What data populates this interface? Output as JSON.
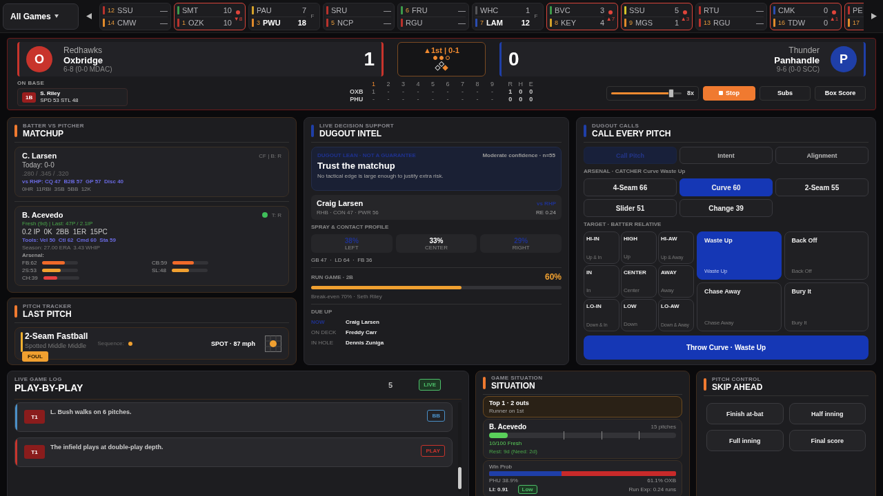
{
  "ticker": {
    "menu": "All Games",
    "games": [
      {
        "live": false,
        "teams": [
          {
            "seed": "12",
            "abbr": "SSU",
            "score": "—",
            "color": "#b8322c",
            "winner": false
          },
          {
            "seed": "14",
            "abbr": "CMW",
            "score": "—",
            "color": "#e08a2a",
            "winner": false
          }
        ]
      },
      {
        "live": true,
        "inning": "▼8",
        "teams": [
          {
            "abbr": "SMT",
            "score": "10",
            "color": "#3d9a4a",
            "winner": false
          },
          {
            "seed": "1",
            "abbr": "OZK",
            "score": "10",
            "color": "#b8322c",
            "winner": false
          }
        ]
      },
      {
        "live": false,
        "status": "F",
        "teams": [
          {
            "abbr": "PAU",
            "score": "7",
            "color": "#d4a22a",
            "winner": false
          },
          {
            "seed": "3",
            "abbr": "PWU",
            "score": "18",
            "color": "#e08a2a",
            "winner": true
          }
        ]
      },
      {
        "live": false,
        "teams": [
          {
            "abbr": "SRU",
            "score": "—",
            "color": "#b8322c",
            "winner": false
          },
          {
            "seed": "5",
            "abbr": "NCP",
            "score": "—",
            "color": "#b8322c",
            "winner": false
          }
        ]
      },
      {
        "live": false,
        "teams": [
          {
            "seed": "6",
            "abbr": "FRU",
            "score": "—",
            "color": "#3d9a4a",
            "winner": false
          },
          {
            "abbr": "RGU",
            "score": "—",
            "color": "#b8322c",
            "winner": false
          }
        ]
      },
      {
        "live": false,
        "status": "F",
        "teams": [
          {
            "abbr": "WHC",
            "score": "1",
            "color": "#555558",
            "winner": false
          },
          {
            "seed": "7",
            "abbr": "LAM",
            "score": "12",
            "color": "#2b4db0",
            "winner": true
          }
        ]
      },
      {
        "live": true,
        "inning": "▲7",
        "teams": [
          {
            "abbr": "BVC",
            "score": "3",
            "color": "#3d9a4a",
            "winner": false
          },
          {
            "seed": "8",
            "abbr": "KEY",
            "score": "4",
            "color": "#d4a22a",
            "winner": false
          }
        ]
      },
      {
        "live": true,
        "inning": "▲3",
        "teams": [
          {
            "abbr": "SSU",
            "score": "5",
            "color": "#d4c42a",
            "winner": false
          },
          {
            "seed": "9",
            "abbr": "MGS",
            "score": "1",
            "color": "#e08a2a",
            "winner": false
          }
        ]
      },
      {
        "live": false,
        "teams": [
          {
            "abbr": "RTU",
            "score": "—",
            "color": "#b8322c",
            "winner": false
          },
          {
            "seed": "13",
            "abbr": "RGU",
            "score": "—",
            "color": "#b8322c",
            "winner": false
          }
        ]
      },
      {
        "live": true,
        "inning": "▲1",
        "teams": [
          {
            "abbr": "CMK",
            "score": "0",
            "color": "#2b4db0",
            "winner": false
          },
          {
            "seed": "16",
            "abbr": "TDW",
            "score": "0",
            "color": "#e08a2a",
            "winner": false
          }
        ]
      },
      {
        "live": true,
        "teams": [
          {
            "abbr": "PE",
            "color": "#b8322c"
          },
          {
            "seed": "17",
            "color": "#e08a2a"
          }
        ]
      }
    ]
  },
  "scoreboard": {
    "away": {
      "nickname": "Redhawks",
      "name": "Oxbridge",
      "record": "6-8  (0-0 MDAC)",
      "logo": "O",
      "color": "#c8342c",
      "score": "1"
    },
    "home": {
      "nickname": "Thunder",
      "name": "Panhandle",
      "record": "9-6  (0-0 SCC)",
      "logo": "P",
      "color": "#1f3fa8",
      "score": "0"
    },
    "status": {
      "inning": "▲1st | 0-1",
      "outs": [
        true,
        true,
        false
      ],
      "bases": {
        "first": true,
        "second": false,
        "third": false
      }
    },
    "on_base": {
      "label": "ON BASE",
      "runners": [
        {
          "base": "1B",
          "name": "S. Riley",
          "stats": "SPD 53  STL 48"
        }
      ]
    },
    "linescore": {
      "innings": [
        {
          "label": "1",
          "selected": true
        },
        {
          "label": "2",
          "selected": false
        },
        {
          "label": "3",
          "selected": false
        },
        {
          "label": "4",
          "selected": false
        },
        {
          "label": "5",
          "selected": false
        },
        {
          "label": "6",
          "selected": false
        },
        {
          "label": "7",
          "selected": false
        },
        {
          "label": "8",
          "selected": false
        },
        {
          "label": "9",
          "selected": false
        }
      ],
      "totals": [
        "R",
        "H",
        "E"
      ],
      "rows": [
        {
          "team": "OXB",
          "innings": [
            "1",
            "-",
            "-",
            "-",
            "-",
            "-",
            "-",
            "-",
            "-"
          ],
          "totals": [
            "1",
            "0",
            "0"
          ]
        },
        {
          "team": "PHU",
          "innings": [
            "-",
            "-",
            "-",
            "-",
            "-",
            "-",
            "-",
            "-",
            "-"
          ],
          "totals": [
            "0",
            "0",
            "0"
          ]
        }
      ]
    },
    "controls": {
      "speed": {
        "reading": "8x"
      },
      "buttons": [
        {
          "label": "Stop",
          "kind": "stop",
          "selected": true
        },
        {
          "label": "Subs",
          "kind": "plain",
          "selected": false
        },
        {
          "label": "Box Score",
          "kind": "plain",
          "selected": false
        }
      ]
    }
  },
  "matchup": {
    "eyebrow": "BATTER VS PITCHER",
    "title": "MATCHUP",
    "batter": {
      "name": "C. Larsen",
      "position": "CF | B: R",
      "today": "Today: 0-0",
      "slash": ".280 / .345 / .320",
      "splits": "vs RHP: CQ 47  B2B 57  GP 57  Disc 40",
      "totals": "0HR  11RBI  3SB  5BB  12K"
    },
    "pitcher": {
      "name": "B. Acevedo",
      "available": true,
      "throws": "T: R",
      "fresh": "Fresh (9d) | Last: 47P / 2.1IP",
      "line": "0.2 IP  0K  2BB  1ER  15PC",
      "tools": "Tools: Vel 50  Ctl 62  Cmd 60  Sta 59",
      "season": "Season: 27.00 ERA  3.43 WHIP",
      "arsenal_label": "Arsenal:",
      "arsenal": [
        {
          "label": "FB:62",
          "level": 0.62,
          "color": "#f06a2a"
        },
        {
          "label": "CB:59",
          "level": 0.59,
          "color": "#f06a2a"
        },
        {
          "label": "2S:53",
          "level": 0.53,
          "color": "#f0a030"
        },
        {
          "label": "SL:48",
          "level": 0.48,
          "color": "#f0a030"
        },
        {
          "label": "CH:39",
          "level": 0.39,
          "color": "#e84040"
        }
      ]
    }
  },
  "pitch_tracker": {
    "eyebrow": "PITCH TRACKER",
    "title": "LAST PITCH",
    "pitch": "2-Seam Fastball",
    "location": "Spotted Middle Middle",
    "result": "FOUL",
    "sequence_label": "Sequence:",
    "sequence": [
      {
        "color": "#f0a030"
      }
    ],
    "reading": "SPOT · 87 mph"
  },
  "dugout_intel": {
    "eyebrow": "LIVE DECISION SUPPORT",
    "title": "DUGOUT INTEL",
    "lean": {
      "label": "DUGOUT LEAN · NOT A GUARANTEE",
      "confidence": "Moderate confidence · n=55",
      "headline": "Trust the matchup",
      "detail": "No tactical edge is large enough to justify extra risk."
    },
    "batter": {
      "name": "Craig Larsen",
      "profile": "RHB · CON 47 · PWR 56",
      "split": "vs RHP",
      "run_expectancy": "RE 0.24"
    },
    "spray_heading": "SPRAY & CONTACT PROFILE",
    "spray": [
      {
        "value": "38%",
        "label": "LEFT",
        "emphasis": false
      },
      {
        "value": "33%",
        "label": "CENTER",
        "emphasis": true
      },
      {
        "value": "29%",
        "label": "RIGHT",
        "emphasis": false
      }
    ],
    "contact": "GB 47  ·  LD 64  ·  FB 36",
    "run_game": {
      "label": "RUN GAME · 2B",
      "value": "60%",
      "level": 0.6,
      "note": "Break-even 70% · Seth Riley"
    },
    "due_up": {
      "heading": "DUE UP",
      "rows": [
        {
          "slot": "NOW",
          "name": "Craig Larsen",
          "current": true
        },
        {
          "slot": "ON DECK",
          "name": "Freddy Carr",
          "current": false
        },
        {
          "slot": "IN HOLE",
          "name": "Dennis Zuniga",
          "current": false
        }
      ]
    }
  },
  "pitch_calls": {
    "eyebrow": "DUGOUT CALLS",
    "title": "CALL EVERY PITCH",
    "tabs": [
      {
        "label": "Call Pitch",
        "selected": true
      },
      {
        "label": "Intent",
        "selected": false
      },
      {
        "label": "Alignment",
        "selected": false
      }
    ],
    "arsenal_label": "ARSENAL · CATCHER Curve Waste Up",
    "pitches": [
      {
        "label": "4-Seam 66",
        "selected": false
      },
      {
        "label": "Curve 60",
        "selected": true
      },
      {
        "label": "2-Seam 55",
        "selected": false
      },
      {
        "label": "Slider 51",
        "selected": false
      },
      {
        "label": "Change 39",
        "selected": false
      }
    ],
    "target_label": "TARGET · BATTER RELATIVE",
    "zones": [
      {
        "code": "HI-IN",
        "hint": "Up & In",
        "selected": false
      },
      {
        "code": "HIGH",
        "hint": "Up",
        "selected": false
      },
      {
        "code": "HI-AW",
        "hint": "Up & Away",
        "selected": false
      },
      {
        "code": "IN",
        "hint": "In",
        "selected": false
      },
      {
        "code": "CENTER",
        "hint": "Center",
        "selected": false
      },
      {
        "code": "AWAY",
        "hint": "Away",
        "selected": false
      },
      {
        "code": "LO-IN",
        "hint": "Down & In",
        "selected": false
      },
      {
        "code": "LOW",
        "hint": "Down",
        "selected": false
      },
      {
        "code": "LO-AW",
        "hint": "Down & Away",
        "selected": false
      }
    ],
    "intents": [
      {
        "title": "Waste Up",
        "hint": "Waste Up",
        "selected": true
      },
      {
        "title": "Back Off",
        "hint": "Back Off",
        "selected": false
      },
      {
        "title": "Chase Away",
        "hint": "Chase Away",
        "selected": false
      },
      {
        "title": "Bury It",
        "hint": "Bury It",
        "selected": false
      }
    ],
    "action": "Throw Curve · Waste Up"
  },
  "play_by_play": {
    "eyebrow": "LIVE GAME LOG",
    "title": "PLAY-BY-PLAY",
    "count": "5",
    "badge": "LIVE",
    "entries": [
      {
        "inning": "T1",
        "text": "L. Bush walks on 6 pitches.",
        "tag": "BB",
        "color": "#4a90c8"
      },
      {
        "inning": "T1",
        "text": "The infield plays at double-play depth.",
        "tag": "PLAY",
        "color": "#c8342c"
      }
    ]
  },
  "situation": {
    "eyebrow": "GAME SITUATION",
    "title": "SITUATION",
    "state": {
      "headline": "Top 1 · 2 outs",
      "detail": "Runner on 1st"
    },
    "pitcher": {
      "name": "B. Acevedo",
      "pitches": "15 pitches",
      "level": 0.1,
      "fatigue": "10/100 Fresh",
      "rest": "Rest: 9d (Need: 2d)"
    },
    "win_prob": {
      "label": "Win Prob",
      "level": 0.389,
      "home": "PHU 38.9%",
      "away": "61.1% OXB",
      "leverage": "LI: 0.91",
      "leverage_tag": "Low",
      "run_exp": "Run Exp: 0.24 runs"
    }
  },
  "skip_ahead": {
    "eyebrow": "PITCH CONTROL",
    "title": "SKIP AHEAD",
    "buttons": [
      "Finish at-bat",
      "Half inning",
      "Full inning",
      "Final score"
    ]
  }
}
